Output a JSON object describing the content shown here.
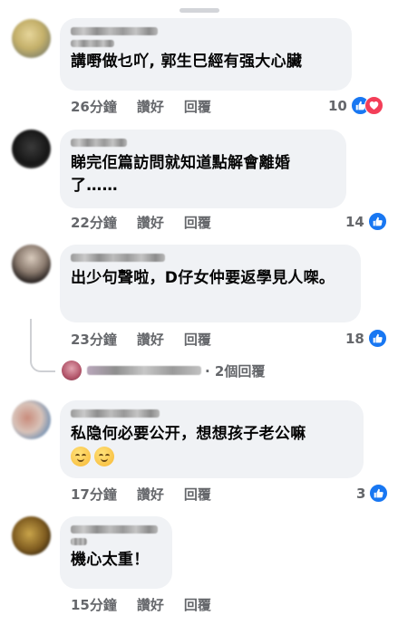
{
  "comments": [
    {
      "text": "講嘢做乜吖, 郭生巳經有强大心臟",
      "time": "26分鐘",
      "like": "讚好",
      "reply": "回覆",
      "reactions": "10"
    },
    {
      "text": "睇完佢篇訪問就知道點解會離婚了……",
      "time": "22分鐘",
      "like": "讚好",
      "reply": "回覆",
      "reactions": "14"
    },
    {
      "text": "出少句聲啦，D仔女仲要返學見人㗎。",
      "time": "23分鐘",
      "like": "讚好",
      "reply": "回覆",
      "reactions": "18"
    },
    {
      "text": "私隐何必要公开，想想孩子老公嘛",
      "time": "17分鐘",
      "like": "讚好",
      "reply": "回覆",
      "reactions": "3"
    },
    {
      "text": "機心太重！",
      "time": "15分鐘",
      "like": "讚好",
      "reply": "回覆"
    }
  ],
  "replies_link": "· 2個回覆",
  "colors": {
    "like_blue": "#1877f2",
    "love_red": "#f33e58",
    "bubble_bg": "#f0f2f5",
    "meta_gray": "#65676b"
  }
}
